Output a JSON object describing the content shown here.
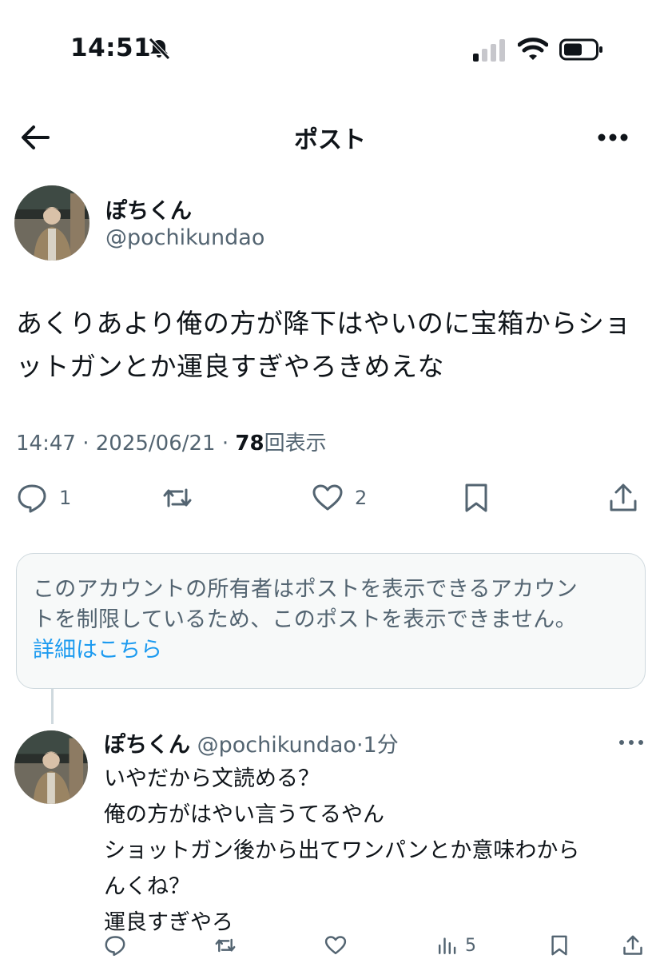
{
  "status_bar": {
    "time": "14:51"
  },
  "nav": {
    "title": "ポスト"
  },
  "post": {
    "author_name": "ぽちくん",
    "author_handle": "@pochikundao",
    "body_lines": [
      "あくりあより俺の方が降下はやいのに宝箱からショ",
      "ットガンとか運良すぎやろきめえな"
    ],
    "time": "14:47",
    "sep1": "·",
    "date": "2025/06/21",
    "sep2": "·",
    "views_count": "78",
    "views_label": "回表示",
    "reply_count": "1",
    "like_count": "2"
  },
  "notice": {
    "lines": [
      "このアカウントの所有者はポストを表示できるアカウン",
      "トを制限しているため、このポストを表示できません。"
    ],
    "link": "詳細はこちら"
  },
  "reply": {
    "author_name": "ぽちくん",
    "author_handle": "@pochikundao",
    "dot": "·",
    "time": "1分",
    "body_lines": [
      "いやだから文読める？",
      "俺の方がはやい言うてるやん",
      "ショットガン後から出てワンパンとか意味わから",
      "んくね？",
      "運良すぎやろ"
    ],
    "view_count": "5"
  },
  "icons": {
    "back": "arrow-left-icon",
    "more": "more-horizontal-icon",
    "reply": "speech-bubble-icon",
    "repost": "repost-icon",
    "like": "heart-icon",
    "bookmark": "bookmark-icon",
    "share": "share-icon",
    "views": "bar-chart-icon"
  },
  "colors": {
    "text": "#0f1419",
    "secondary": "#536471",
    "link": "#1d9bf0"
  }
}
